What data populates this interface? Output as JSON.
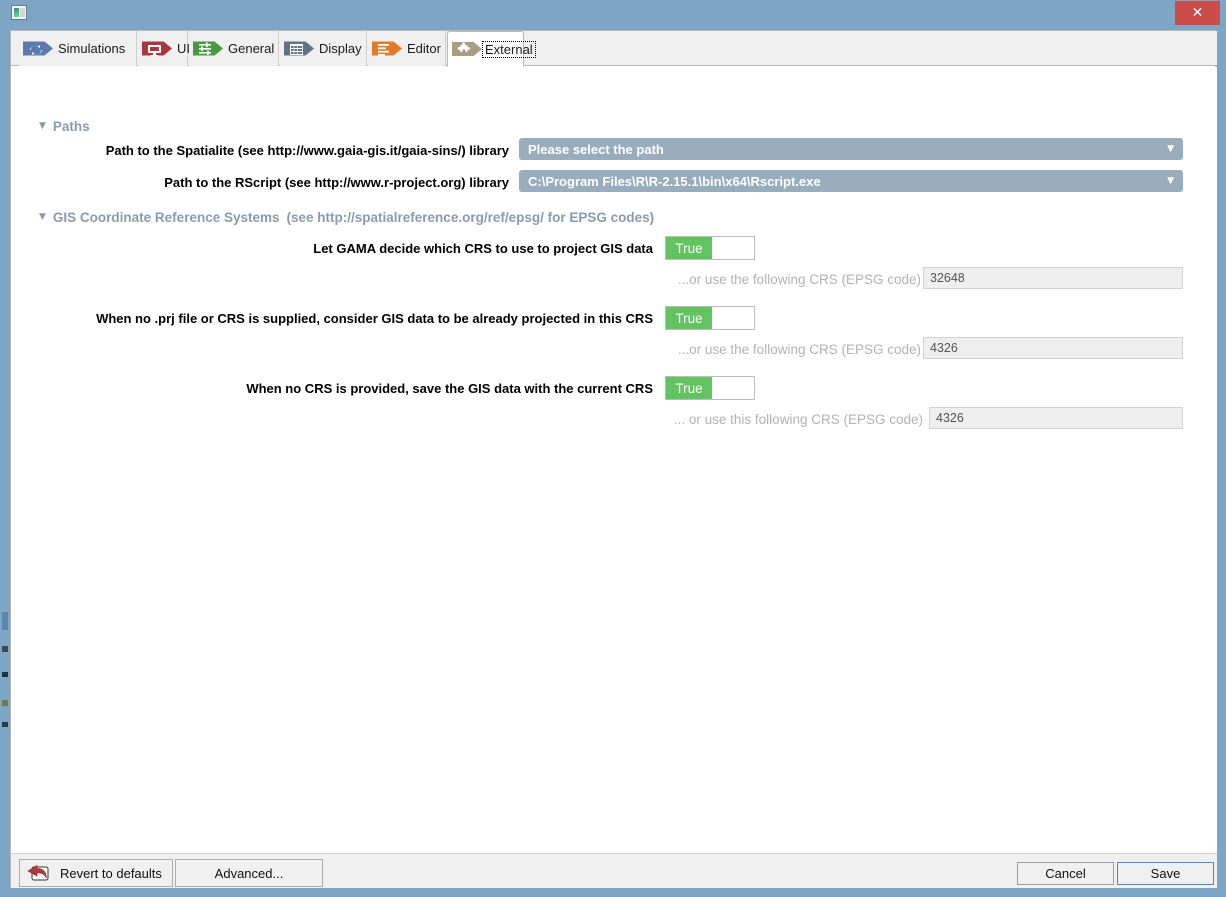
{
  "window": {
    "title": "",
    "app_icon": "gama-window-icon",
    "close_label": "✕",
    "titlebar_color": "#7ea6c4",
    "close_color": "#cc4b4b"
  },
  "tabs": [
    {
      "id": "simulations",
      "label": "Simulations",
      "icon": "refresh-icon",
      "color": "#5b7bb0",
      "active": false
    },
    {
      "id": "ui",
      "label": "UI",
      "icon": "monitor-icon",
      "color": "#a8373f",
      "active": false
    },
    {
      "id": "general",
      "label": "General",
      "icon": "sliders-icon",
      "color": "#4a9a45",
      "active": false
    },
    {
      "id": "display",
      "label": "Display",
      "icon": "grid-icon",
      "color": "#5f7384",
      "active": false
    },
    {
      "id": "editor",
      "label": "Editor",
      "icon": "lines-icon",
      "color": "#e07b2a",
      "active": false
    },
    {
      "id": "external",
      "label": "External",
      "icon": "puzzle-icon",
      "color": "#ab9c84",
      "active": true
    }
  ],
  "sections": {
    "paths": {
      "title": "Paths",
      "twisty": "▼",
      "expanded": true,
      "rows": [
        {
          "label": "Path to the Spatialite (see http://www.gaia-gis.it/gaia-sins/) library",
          "value": "Please select the path",
          "arrow": "▼"
        },
        {
          "label": "Path to the RScript (see http://www.r-project.org) library",
          "value": "C:\\Program Files\\R\\R-2.15.1\\bin\\x64\\Rscript.exe",
          "arrow": "▼"
        }
      ]
    },
    "gis": {
      "title": "GIS Coordinate Reference Systems",
      "subtitle": "(see http://spatialreference.org/ref/epsg/ for EPSG codes)",
      "twisty": "▼",
      "expanded": true,
      "rows": [
        {
          "label": "Let GAMA decide which CRS to use to project GIS data",
          "toggle_value": "True",
          "sub_label": "...or use the following CRS (EPSG code)",
          "epsg_value": "32648"
        },
        {
          "label": "When no .prj file or CRS is supplied, consider GIS data to be already projected in this CRS",
          "toggle_value": "True",
          "sub_label": "...or use the following CRS (EPSG code)",
          "epsg_value": "4326"
        },
        {
          "label": "When no CRS is provided, save the GIS data with the current CRS",
          "toggle_value": "True",
          "sub_label": "... or use this following CRS (EPSG code)",
          "epsg_value": "4326"
        }
      ]
    }
  },
  "buttons": {
    "revert": "Revert to defaults",
    "advanced": "Advanced...",
    "cancel": "Cancel",
    "save": "Save"
  },
  "colors": {
    "toggle_on": "#63c361",
    "combo_bg": "#9aadbd",
    "section_header": "#8a9bb0",
    "focus_blue": "#3d8fd1"
  }
}
